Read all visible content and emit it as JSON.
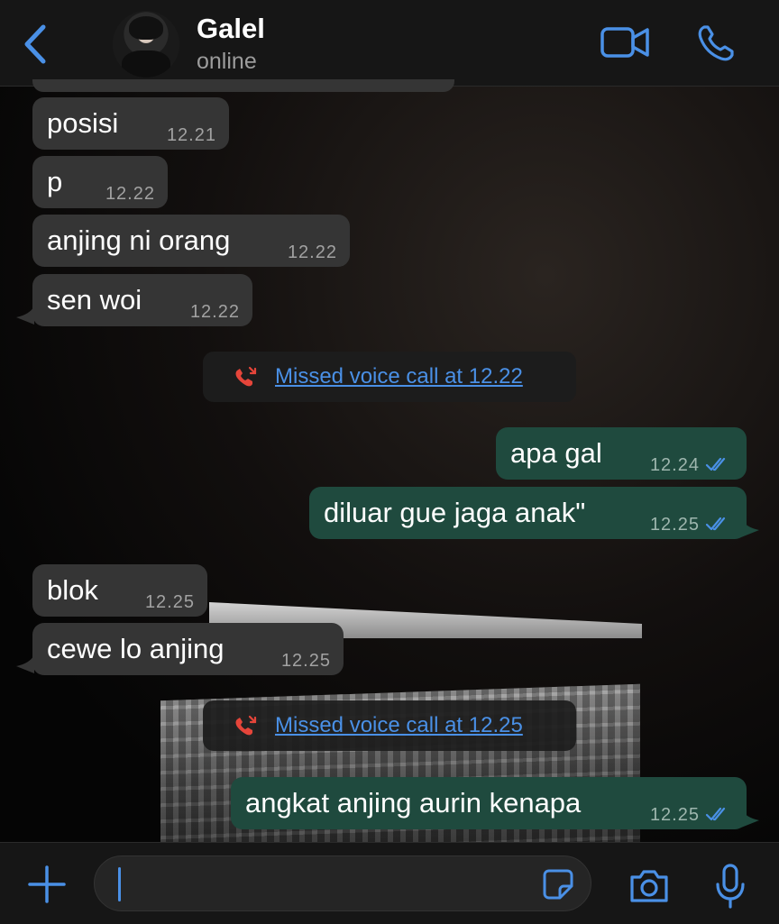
{
  "header": {
    "contact_name": "Galel",
    "status": "online",
    "back_icon": "chevron-left-icon",
    "video_icon": "video-camera-icon",
    "phone_icon": "phone-icon"
  },
  "messages": [
    {
      "dir": "in",
      "text": "posisi",
      "time": "12.21"
    },
    {
      "dir": "in",
      "text": "p",
      "time": "12.22"
    },
    {
      "dir": "in",
      "text": "anjing ni orang",
      "time": "12.22"
    },
    {
      "dir": "in",
      "text": "sen woi",
      "time": "12.22"
    },
    {
      "dir": "system",
      "text": "Missed voice call at 12.22"
    },
    {
      "dir": "out",
      "text": "apa gal",
      "time": "12.24",
      "status": "read"
    },
    {
      "dir": "out",
      "text": "diluar gue jaga anak\"",
      "time": "12.25",
      "status": "read"
    },
    {
      "dir": "in",
      "text": "blok",
      "time": "12.25"
    },
    {
      "dir": "in",
      "text": "cewe lo anjing",
      "time": "12.25"
    },
    {
      "dir": "system",
      "text": "Missed voice call at 12.25"
    },
    {
      "dir": "out",
      "text": "angkat anjing aurin kenapa",
      "time": "12.25",
      "status": "read"
    }
  ],
  "composer": {
    "input_value": "",
    "plus_icon": "plus-icon",
    "sticker_icon": "sticker-icon",
    "camera_icon": "camera-icon",
    "mic_icon": "microphone-icon"
  },
  "colors": {
    "accent": "#4a90e6",
    "incoming_bubble": "#353535",
    "outgoing_bubble": "#1f4a3e",
    "missed_call_icon": "#e5453a"
  }
}
